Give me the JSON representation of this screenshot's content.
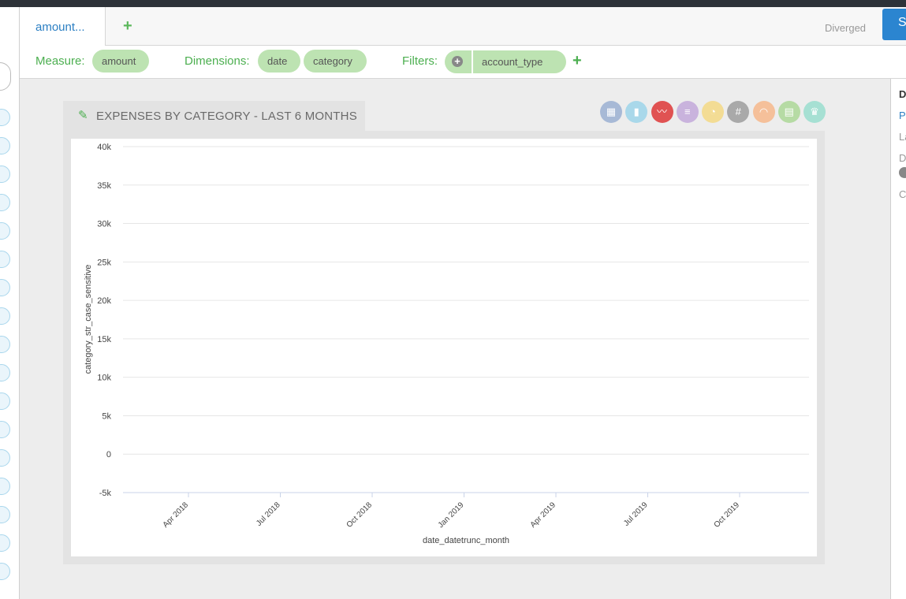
{
  "tabs": {
    "active_label": "amount...",
    "add_label": "+"
  },
  "status": {
    "diverged": "Diverged"
  },
  "save_button": {
    "label": "S"
  },
  "query": {
    "measure_label": "Measure:",
    "measure": "amount",
    "dimensions_label": "Dimensions:",
    "dimensions": [
      "date",
      "category"
    ],
    "filters_label": "Filters:",
    "filter_add_icon": "+",
    "filters": [
      "account_type"
    ],
    "add_filter": "+"
  },
  "right_panel": {
    "items": [
      "D",
      "P",
      "La",
      "D",
      "C"
    ]
  },
  "chart_tab": {
    "title": "EXPENSES BY CATEGORY - LAST 6 MONTHS"
  },
  "chart_types": [
    {
      "name": "table-icon",
      "color": "#a7b9d6"
    },
    {
      "name": "bar-chart-icon",
      "color": "#a9d8ea"
    },
    {
      "name": "line-chart-icon",
      "color": "#e05252"
    },
    {
      "name": "horizontal-bar-icon",
      "color": "#c9b3dd"
    },
    {
      "name": "gauge-icon",
      "color": "#f3dc94"
    },
    {
      "name": "number-icon",
      "color": "#a9a9a9"
    },
    {
      "name": "speedometer-icon",
      "color": "#f5c09a"
    },
    {
      "name": "combo-icon",
      "color": "#b6dba4"
    },
    {
      "name": "trophy-icon",
      "color": "#a6e0d3"
    }
  ],
  "chart_data": {
    "type": "line",
    "title": "",
    "xlabel": "date_datetrunc_month",
    "ylabel": "category_str_case_sensitive",
    "ylim": [
      -5000,
      40000
    ],
    "y_ticks": [
      40000,
      35000,
      30000,
      25000,
      20000,
      15000,
      10000,
      5000,
      0,
      -5000
    ],
    "y_tick_labels": [
      "40k",
      "35k",
      "30k",
      "25k",
      "20k",
      "15k",
      "10k",
      "5k",
      "0",
      "-5k"
    ],
    "x_tick_labels": [
      "Apr 2018",
      "Jul 2018",
      "Oct 2018",
      "Jan 2019",
      "Apr 2019",
      "Jul 2019",
      "Oct 2019"
    ],
    "grid": true,
    "series": []
  }
}
